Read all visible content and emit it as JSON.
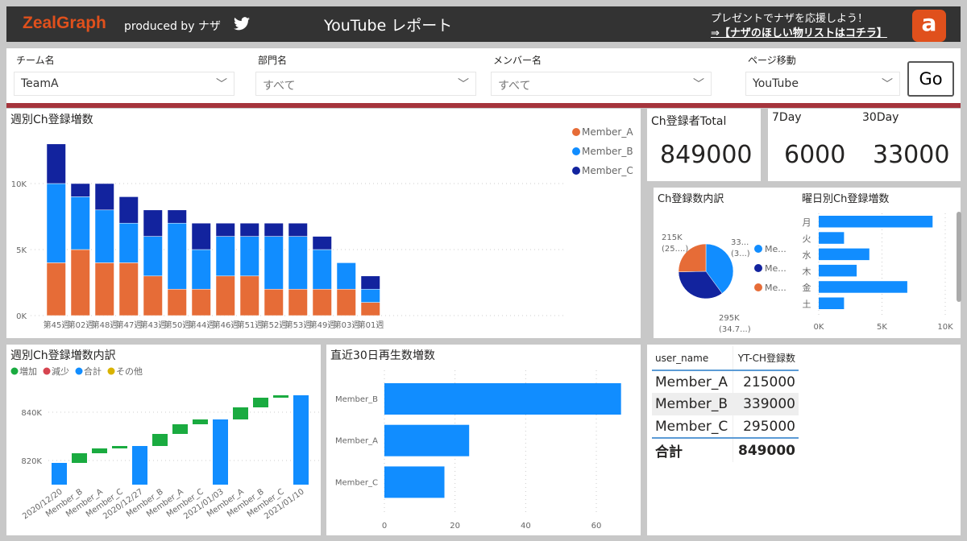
{
  "header": {
    "logo": "ZealGraph",
    "produced_by": "produced by ナザ",
    "title": "YouTube レポート",
    "promo_text": "プレゼントでナザを応援しよう！",
    "promo_link": "⇒【ナザのほしい物リストはコチラ】",
    "twitter_icon": "twitter-icon",
    "amazon_icon": "amazon-icon"
  },
  "filters": {
    "team": {
      "label": "チーム名",
      "value": "TeamA"
    },
    "dept": {
      "label": "部門名",
      "value": "すべて"
    },
    "member": {
      "label": "メンバー名",
      "value": "すべて"
    },
    "page": {
      "label": "ページ移動",
      "value": "YouTube"
    },
    "go_label": "Go"
  },
  "colors": {
    "member_a": "#e66c37",
    "member_b": "#118dff",
    "member_c": "#12239e",
    "increase": "#1aab40",
    "decrease": "#d64550",
    "total": "#118dff",
    "other": "#d9b300",
    "accent": "#a5343c"
  },
  "cards": {
    "total_label": "Ch登録者Total",
    "total_value": "849000",
    "day7_label": "7Day",
    "day7_value": "6000",
    "day30_label": "30Day",
    "day30_value": "33000"
  },
  "chart_data": [
    {
      "type": "bar",
      "stacked": true,
      "title": "週別Ch登録増数",
      "categories": [
        "第45週",
        "第02週",
        "第48週",
        "第47週",
        "第43週",
        "第50週",
        "第44週",
        "第46週",
        "第51週",
        "第52週",
        "第53週",
        "第49週",
        "第03週",
        "第01週"
      ],
      "series": [
        {
          "name": "Member_A",
          "values": [
            4000,
            5000,
            4000,
            4000,
            3000,
            2000,
            2000,
            3000,
            3000,
            2000,
            2000,
            2000,
            2000,
            1000
          ]
        },
        {
          "name": "Member_B",
          "values": [
            6000,
            4000,
            4000,
            3000,
            3000,
            5000,
            3000,
            3000,
            3000,
            4000,
            4000,
            3000,
            2000,
            1000
          ]
        },
        {
          "name": "Member_C",
          "values": [
            3000,
            1000,
            2000,
            2000,
            2000,
            1000,
            2000,
            1000,
            1000,
            1000,
            1000,
            1000,
            0,
            1000
          ]
        }
      ],
      "yticks": [
        "0K",
        "5K",
        "10K"
      ],
      "ylim": [
        0,
        13500
      ],
      "legend": "top-right",
      "grid": true
    },
    {
      "type": "pie",
      "title": "Ch登録数内訳",
      "slices": [
        {
          "name": "Member_B",
          "value": 339000,
          "label": "33...",
          "pct_label": "(3...)"
        },
        {
          "name": "Member_C",
          "value": 295000,
          "label": "295K",
          "pct_label": "(34.7...)"
        },
        {
          "name": "Member_A",
          "value": 215000,
          "label": "215K",
          "pct_label": "(25....)"
        }
      ],
      "legend_labels": [
        "Me...",
        "Me...",
        "Me..."
      ]
    },
    {
      "type": "bar",
      "orientation": "horizontal",
      "title": "曜日別Ch登録増数",
      "categories": [
        "月",
        "火",
        "水",
        "木",
        "金",
        "土"
      ],
      "values": [
        9000,
        2000,
        4000,
        3000,
        7000,
        2000
      ],
      "xticks": [
        "0K",
        "5K",
        "10K"
      ],
      "xlim": [
        0,
        10000
      ]
    },
    {
      "type": "waterfall",
      "title": "週別Ch登録増数内訳",
      "legend": [
        "増加",
        "減少",
        "合計",
        "その他"
      ],
      "categories": [
        "2020/12/20",
        "Member_B",
        "Member_A",
        "Member_C",
        "2020/12/27",
        "Member_B",
        "Member_A",
        "Member_C",
        "2021/01/03",
        "Member_A",
        "Member_B",
        "Member_C",
        "2021/01/10"
      ],
      "values": [
        819000,
        4000,
        2000,
        1000,
        826000,
        5000,
        4000,
        2000,
        837000,
        5000,
        4000,
        1000,
        847000
      ],
      "kinds": [
        "total",
        "increase",
        "increase",
        "increase",
        "total",
        "increase",
        "increase",
        "increase",
        "total",
        "increase",
        "increase",
        "increase",
        "total"
      ],
      "yticks": [
        "820K",
        "840K"
      ],
      "ylim": [
        810000,
        850000
      ]
    },
    {
      "type": "bar",
      "orientation": "horizontal",
      "title": "直近30日再生数増数",
      "categories": [
        "Member_B",
        "Member_A",
        "Member_C"
      ],
      "values": [
        67,
        24,
        17
      ],
      "xticks": [
        "0",
        "20",
        "40",
        "60"
      ],
      "xlim": [
        0,
        70
      ]
    }
  ],
  "table": {
    "headers": [
      "user_name",
      "YT-CH登録数"
    ],
    "rows": [
      [
        "Member_A",
        "215000"
      ],
      [
        "Member_B",
        "339000"
      ],
      [
        "Member_C",
        "295000"
      ]
    ],
    "total": [
      "合計",
      "849000"
    ]
  }
}
